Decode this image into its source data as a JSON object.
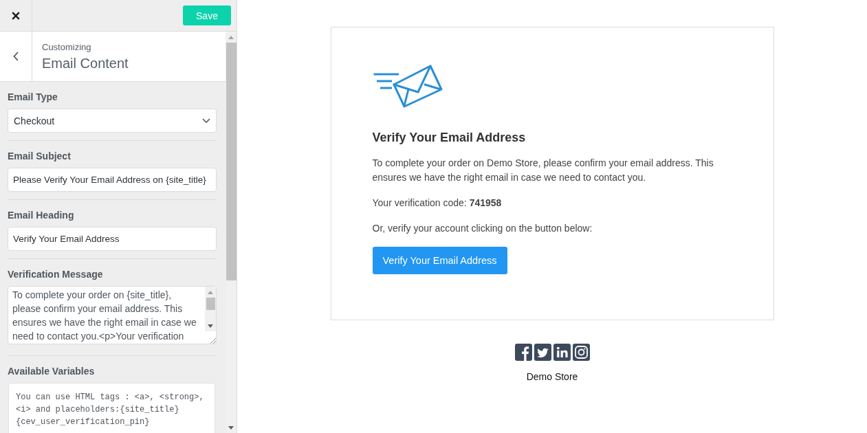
{
  "top_bar": {
    "save_button": "Save"
  },
  "header": {
    "breadcrumb": "Customizing",
    "title": "Email Content"
  },
  "fields": [
    {
      "kind": "select",
      "label": "Email Type",
      "value": "Checkout"
    },
    {
      "kind": "text",
      "label": "Email Subject",
      "value": "Please Verify Your Email Address on {site_title}"
    },
    {
      "kind": "text",
      "label": "Email Heading",
      "value": "Verify Your Email Address"
    },
    {
      "kind": "textarea",
      "label": "Verification Message",
      "value": "To complete your order on {site_title}, please confirm your email address. This ensures we have the right email in case we need to contact you.<p>Your verification"
    },
    {
      "kind": "info",
      "label": "Available Variables",
      "value": "You can use HTML tags : <a>, <strong>, <i> and placeholders:{site_title} {cev_user_verification_pin}"
    }
  ],
  "preview": {
    "heading": "Verify Your Email Address",
    "paragraphs": [
      "To complete your order on Demo Store, please confirm your email address. This ensures we have the right email in case we need to contact you.",
      "Your verification code: **741958**",
      "Or, verify your account clicking on the button below:"
    ],
    "button": "Verify Your Email Address",
    "footer": {
      "store_name": "Demo Store"
    }
  }
}
